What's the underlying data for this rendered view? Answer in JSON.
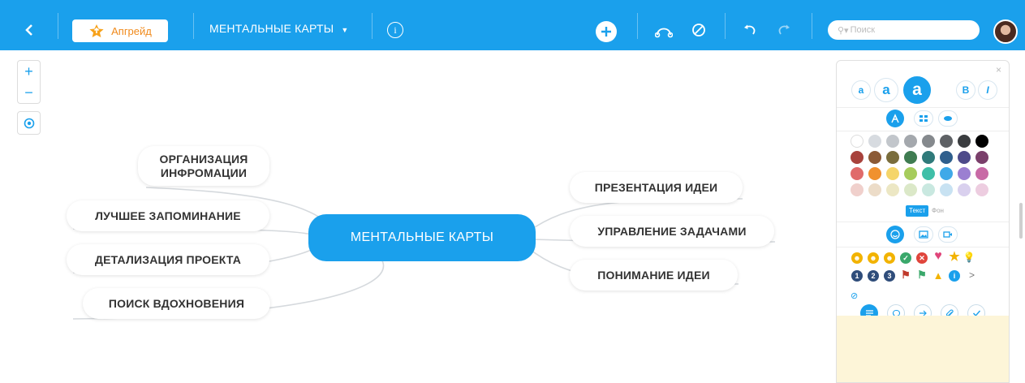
{
  "toolbar": {
    "upgrade_label": "Апгрейд",
    "map_title": "МЕНТАЛЬНЫЕ КАРТЫ",
    "search_placeholder": "Поиск",
    "accent_color": "#1aa0ec"
  },
  "map": {
    "center": "МЕНТАЛЬНЫЕ КАРТЫ",
    "left_nodes": [
      "ОРГАНИЗАЦИЯ ИНФРОМАЦИИ",
      "ЛУЧШЕЕ ЗАПОМИНАНИЕ",
      "ДЕТАЛИЗАЦИЯ ПРОЕКТА",
      "ПОИСК ВДОХНОВЕНИЯ"
    ],
    "right_nodes": [
      "ПРЕЗЕНТАЦИЯ ИДЕИ",
      "УПРАВЛЕНИЕ ЗАДАЧАМИ",
      "ПОНИМАНИЕ ИДЕИ"
    ]
  },
  "zoom": {
    "plus": "+",
    "minus": "−"
  },
  "panel": {
    "size_small": "a",
    "size_medium": "a",
    "size_large": "a",
    "bold": "B",
    "italic": "I",
    "tab_text": "Текст",
    "tab_background": "Фон",
    "palette": [
      [
        "#ffffff",
        "#d7dbe0",
        "#c2c6cb",
        "#a4a8ad",
        "#85898d",
        "#5e6165",
        "#3a3c3f",
        "#000000"
      ],
      [
        "#a8423c",
        "#8b5a36",
        "#7a6d3c",
        "#3f7c51",
        "#2f7a7a",
        "#2f5f8d",
        "#4d4a8a",
        "#7a3f6b"
      ],
      [
        "#e06b6b",
        "#f0912f",
        "#f5d56a",
        "#a6cc5c",
        "#3fbfa8",
        "#3fa9e8",
        "#9b7fd1",
        "#c86aa6"
      ],
      [
        "#f0d0cc",
        "#ecdcc8",
        "#ece7c4",
        "#dbe8c8",
        "#c9e8e0",
        "#c8e2f2",
        "#d9d0ee",
        "#edcde0"
      ]
    ],
    "more_icons_label": ">",
    "icon_numbers": [
      "1",
      "2",
      "3"
    ]
  }
}
